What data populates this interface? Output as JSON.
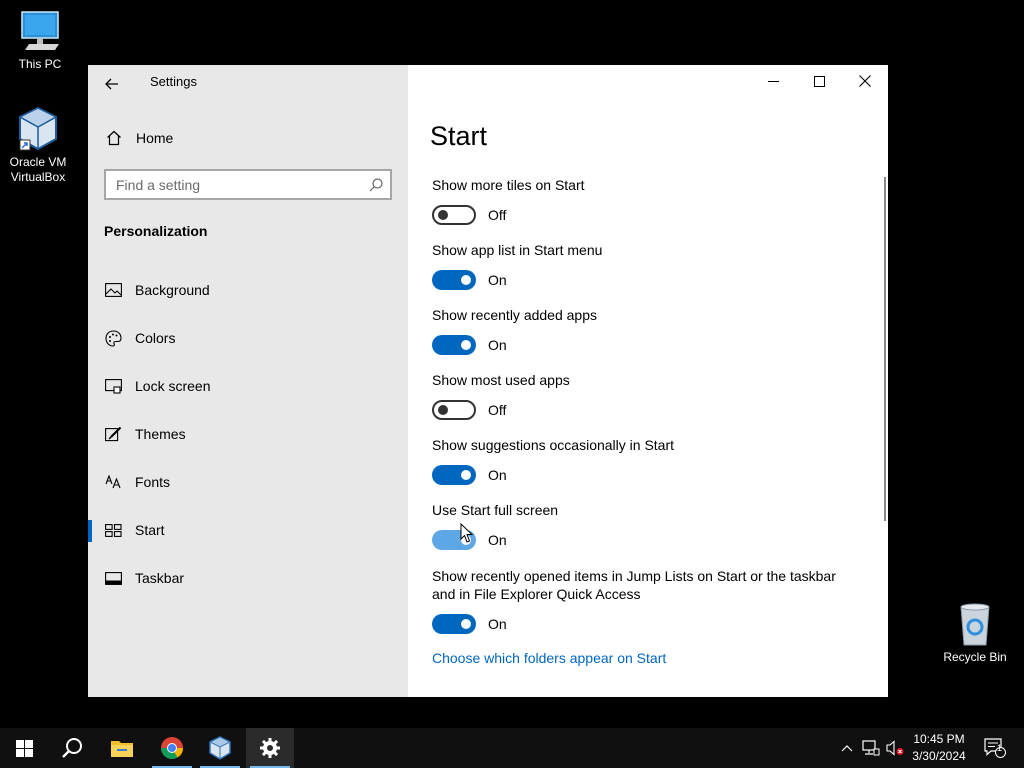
{
  "desktop": {
    "icons": [
      {
        "label": "This PC"
      },
      {
        "label": "Oracle VM\nVirtualBox"
      },
      {
        "label": "Recycle Bin"
      }
    ]
  },
  "window": {
    "title": "Settings"
  },
  "sidebar": {
    "home_label": "Home",
    "search_placeholder": "Find a setting",
    "section_title": "Personalization",
    "items": [
      {
        "label": "Background",
        "icon": "image-icon"
      },
      {
        "label": "Colors",
        "icon": "palette-icon"
      },
      {
        "label": "Lock screen",
        "icon": "lock-screen-icon"
      },
      {
        "label": "Themes",
        "icon": "themes-icon"
      },
      {
        "label": "Fonts",
        "icon": "fonts-icon"
      },
      {
        "label": "Start",
        "icon": "start-icon",
        "active": true
      },
      {
        "label": "Taskbar",
        "icon": "taskbar-icon"
      }
    ]
  },
  "main": {
    "title": "Start",
    "settings": [
      {
        "label": "Show more tiles on Start",
        "state": "Off",
        "on": false
      },
      {
        "label": "Show app list in Start menu",
        "state": "On",
        "on": true
      },
      {
        "label": "Show recently added apps",
        "state": "On",
        "on": true
      },
      {
        "label": "Show most used apps",
        "state": "Off",
        "on": false
      },
      {
        "label": "Show suggestions occasionally in Start",
        "state": "On",
        "on": true
      },
      {
        "label": "Use Start full screen",
        "state": "On",
        "on": true
      },
      {
        "label": "Show recently opened items in Jump Lists on Start or the taskbar and in File Explorer Quick Access",
        "state": "On",
        "on": true
      }
    ],
    "link": "Choose which folders appear on Start"
  },
  "taskbar": {
    "time": "10:45 PM",
    "date": "3/30/2024",
    "notification_count": "1"
  },
  "colors": {
    "accent": "#0067c0",
    "toggle_hover": "#5ea7e6",
    "sidebar_bg": "#e8e8e8",
    "taskbar_bg": "#101010"
  }
}
